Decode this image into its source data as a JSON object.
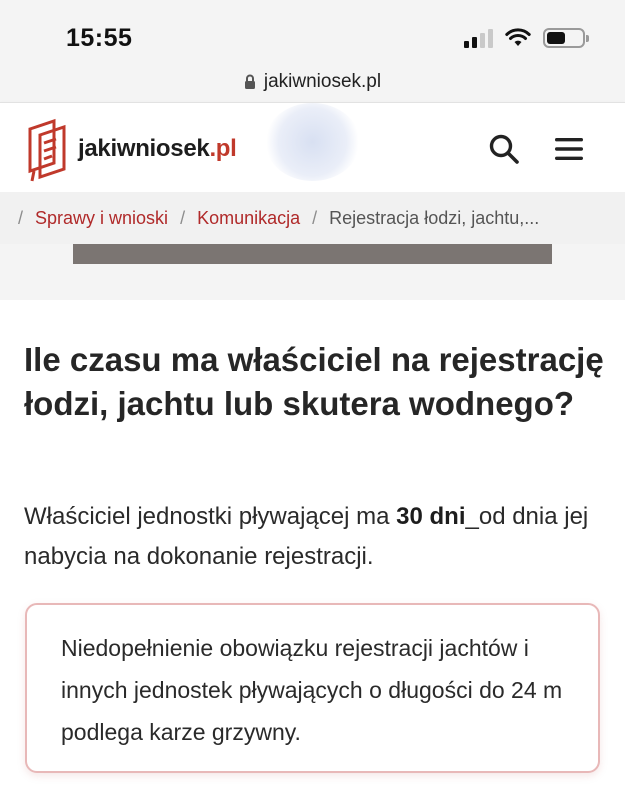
{
  "status_bar": {
    "time": "15:55"
  },
  "browser": {
    "url": "jakiwniosek.pl"
  },
  "site": {
    "brand_main": "jakiwniosek",
    "brand_suffix": ".pl",
    "accent_color": "#c0392b",
    "icons": [
      "search-icon",
      "hamburger-menu-icon"
    ]
  },
  "breadcrumb": {
    "items": [
      "Sprawy i wnioski",
      "Komunikacja",
      "Rejestracja łodzi, jachtu,..."
    ],
    "separator": "/"
  },
  "article": {
    "heading": "Ile czasu ma właściciel na rejestrację łodzi, jachtu lub skutera wodnego?",
    "paragraph_before": "Właściciel jednostki pływającej ma ",
    "paragraph_bold": "30 dni",
    "paragraph_after": "_od dnia jej nabycia na dokonanie rejestracji.",
    "notice": "Niedopełnienie obowiązku rejestracji jachtów i innych jednostek pływających o długości do 24 m podlega karze grzywny."
  }
}
